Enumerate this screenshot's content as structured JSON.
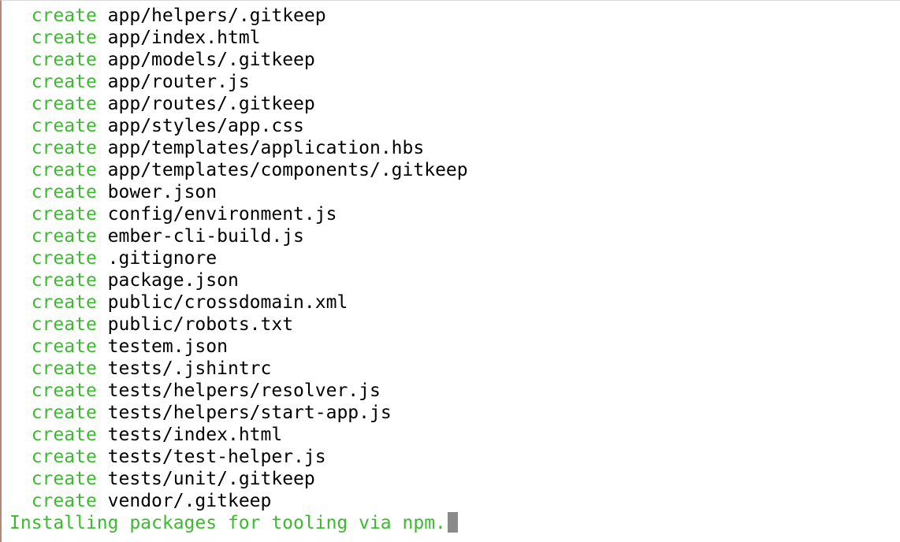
{
  "terminal": {
    "lines": [
      {
        "action": "create",
        "path": "app/helpers/.gitkeep"
      },
      {
        "action": "create",
        "path": "app/index.html"
      },
      {
        "action": "create",
        "path": "app/models/.gitkeep"
      },
      {
        "action": "create",
        "path": "app/router.js"
      },
      {
        "action": "create",
        "path": "app/routes/.gitkeep"
      },
      {
        "action": "create",
        "path": "app/styles/app.css"
      },
      {
        "action": "create",
        "path": "app/templates/application.hbs"
      },
      {
        "action": "create",
        "path": "app/templates/components/.gitkeep"
      },
      {
        "action": "create",
        "path": "bower.json"
      },
      {
        "action": "create",
        "path": "config/environment.js"
      },
      {
        "action": "create",
        "path": "ember-cli-build.js"
      },
      {
        "action": "create",
        "path": ".gitignore"
      },
      {
        "action": "create",
        "path": "package.json"
      },
      {
        "action": "create",
        "path": "public/crossdomain.xml"
      },
      {
        "action": "create",
        "path": "public/robots.txt"
      },
      {
        "action": "create",
        "path": "testem.json"
      },
      {
        "action": "create",
        "path": "tests/.jshintrc"
      },
      {
        "action": "create",
        "path": "tests/helpers/resolver.js"
      },
      {
        "action": "create",
        "path": "tests/helpers/start-app.js"
      },
      {
        "action": "create",
        "path": "tests/index.html"
      },
      {
        "action": "create",
        "path": "tests/test-helper.js"
      },
      {
        "action": "create",
        "path": "tests/unit/.gitkeep"
      },
      {
        "action": "create",
        "path": "vendor/.gitkeep"
      }
    ],
    "status_message": "Installing packages for tooling via npm."
  },
  "colors": {
    "action": "#3cba2f",
    "text": "#000000",
    "cursor": "#8a8a8a",
    "background": "#ffffff"
  }
}
